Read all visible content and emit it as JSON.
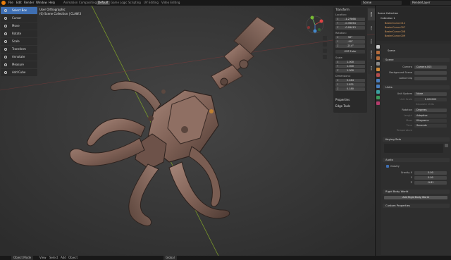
{
  "menu": [
    "File",
    "Edit",
    "Render",
    "Window",
    "Help"
  ],
  "workspaces": [
    "Animation",
    "Compositing",
    "Default",
    "Game Logic",
    "Scripting",
    "UV Editing",
    "Video Editing"
  ],
  "active_workspace": "Default",
  "scene_field": "Scene",
  "view_layer_field": "RenderLayer",
  "viewport": {
    "view_name": "User Orthographic",
    "collection_info": "(0) Scene Collection | CLAW.3"
  },
  "tools": [
    {
      "label": "Select Box",
      "active": true
    },
    {
      "label": "Cursor",
      "active": false
    },
    {
      "label": "Move",
      "active": false
    },
    {
      "label": "Rotate",
      "active": false
    },
    {
      "label": "Scale",
      "active": false
    },
    {
      "label": "Transform",
      "active": false
    },
    {
      "label": "Annotate",
      "active": false
    },
    {
      "label": "Measure",
      "active": false
    },
    {
      "label": "Add Cube",
      "active": false
    }
  ],
  "npanel": {
    "header": "Transform",
    "location_label": "Location:",
    "location": [
      {
        "axis": "X",
        "value": "-1.27868"
      },
      {
        "axis": "Y",
        "value": "-0.35054"
      },
      {
        "axis": "Z",
        "value": "-0.09413"
      }
    ],
    "rotation_label": "Rotation:",
    "rotation": [
      {
        "axis": "X",
        "value": "90°"
      },
      {
        "axis": "Y",
        "value": "-90°"
      },
      {
        "axis": "Z",
        "value": "-214°"
      }
    ],
    "rotation_mode": "XYZ Euler",
    "scale_label": "Scale:",
    "scale": [
      {
        "axis": "X",
        "value": "1.000"
      },
      {
        "axis": "Y",
        "value": "1.000"
      },
      {
        "axis": "Z",
        "value": "1.000"
      }
    ],
    "dimensions_label": "Dimensions:",
    "dimensions": [
      {
        "axis": "X",
        "value": "0.464"
      },
      {
        "axis": "Y",
        "value": "2.831"
      },
      {
        "axis": "Z",
        "value": "0.180"
      }
    ],
    "properties_header": "Properties",
    "edge_tools_header": "Edge Tools",
    "tabs": [
      "Item",
      "Tool",
      "View",
      "3D-Print",
      "Edit"
    ]
  },
  "outliner": {
    "root": "Scene Collection",
    "collection": "Collection 1",
    "items": [
      "BezierCurve.012",
      "BezierCurve.007",
      "BezierCurve.008",
      "BezierCurve.009"
    ]
  },
  "properties": {
    "header": "Scene",
    "scene_section": "Scene",
    "camera_label": "Camera",
    "camera_value": "Camera.003",
    "bg_scene_label": "Background Scene",
    "active_clip_label": "Active Clip",
    "units_section": "Units",
    "unit_system_label": "Unit System",
    "unit_system_value": "None",
    "unit_scale_label": "Unit Scale",
    "unit_scale_value": "1.000000",
    "separate_units_label": "Separate Units",
    "rotation_label": "Rotation",
    "rotation_value": "Degrees",
    "length_label": "Length",
    "length_value": "Adaptive",
    "mass_label": "Mass",
    "mass_value": "Kilograms",
    "time_label": "Time",
    "time_value": "Seconds",
    "temperature_label": "Temperature",
    "keying_sets_section": "Keying Sets",
    "audio_section": "Audio",
    "gravity_label": "Gravity",
    "gravity": [
      {
        "axis": "Gravity X",
        "value": "0.00"
      },
      {
        "axis": "Y",
        "value": "0.00"
      },
      {
        "axis": "Z",
        "value": "-9.81"
      }
    ],
    "rigid_body_section": "Rigid Body World",
    "add_rigid_body_button": "Add Rigid Body World",
    "custom_props_section": "Custom Properties"
  },
  "statusbar": {
    "mode": "Object Mode",
    "menus": [
      "View",
      "Select",
      "Add",
      "Object"
    ],
    "orientation": "Global"
  },
  "colors": {
    "accent": "#3f6fb2",
    "logo": "#e87d0d",
    "claw": "#8a6a5e"
  }
}
